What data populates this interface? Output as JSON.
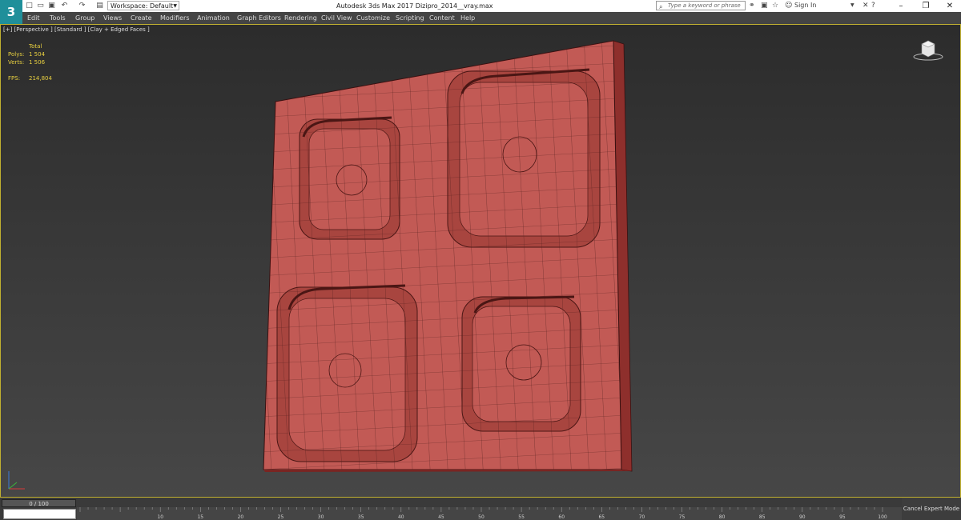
{
  "window": {
    "title": "Autodesk 3ds Max 2017     Dizipro_2014__vray.max",
    "logo": "3"
  },
  "quick_access": {
    "icons": [
      "new-icon",
      "open-icon",
      "save-icon",
      "undo-icon",
      "redo-icon",
      "project-icon"
    ],
    "workspace_label": "Workspace: Default"
  },
  "search": {
    "placeholder": "Type a keyword or phrase",
    "icon": "search-icon"
  },
  "title_icons": {
    "sign_in": "Sign In"
  },
  "menu": [
    "Edit",
    "Tools",
    "Group",
    "Views",
    "Create",
    "Modifiers",
    "Animation",
    "Graph Editors",
    "Rendering",
    "Civil View",
    "Customize",
    "Scripting",
    "Content",
    "Help"
  ],
  "viewport": {
    "label": "[+] [Perspective ] [Standard ] [Clay + Edged Faces ]",
    "stats": {
      "total_label": "Total",
      "polys_label": "Polys:",
      "polys_value": "1 504",
      "verts_label": "Verts:",
      "verts_value": "1 506",
      "fps_label": "FPS:",
      "fps_value": "214,804"
    },
    "mesh_color": "#c25a55"
  },
  "timeline": {
    "slider_label": "0 / 100",
    "ticks": [
      "10",
      "15",
      "20",
      "25",
      "30",
      "35",
      "40",
      "45",
      "50",
      "55",
      "60",
      "65",
      "70",
      "75",
      "80",
      "85",
      "90",
      "95",
      "100"
    ],
    "cancel_label": "Cancel Expert Mode"
  },
  "colors": {
    "accent": "#1f8f9a",
    "viewport_border": "#c0b030",
    "stats_text": "#e8d040"
  }
}
